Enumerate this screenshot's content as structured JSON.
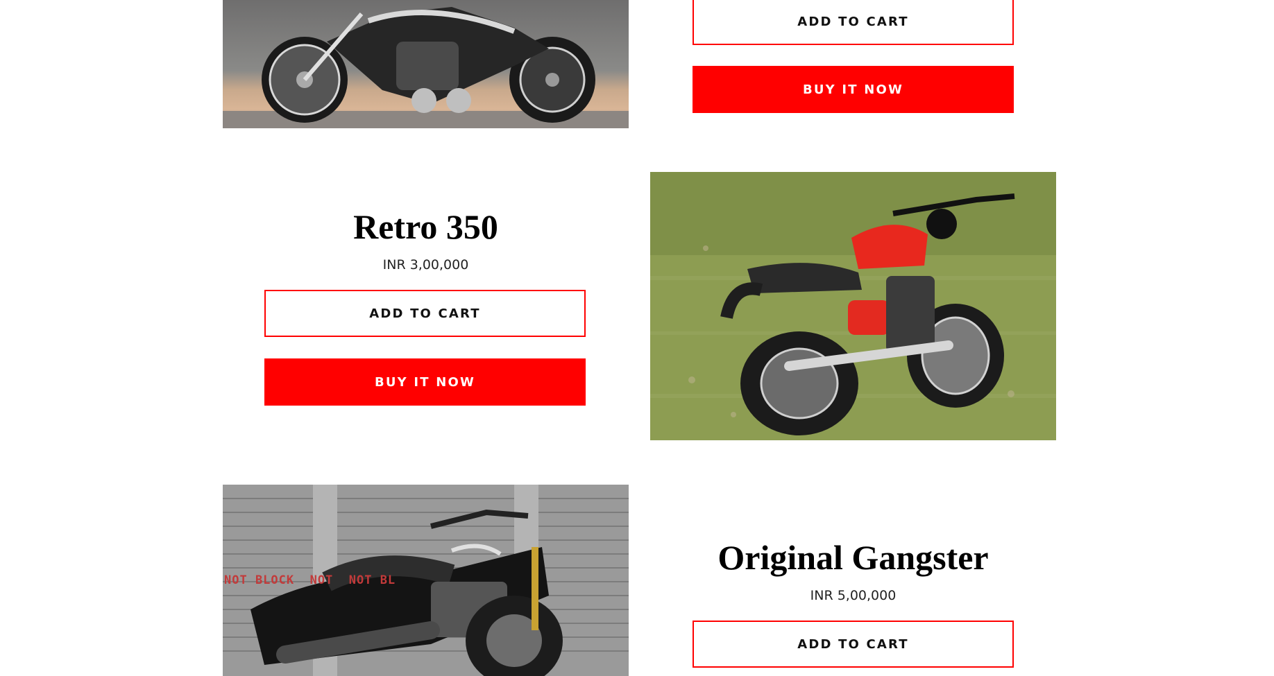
{
  "products": [
    {
      "image_alt": "custom chopper motorcycle",
      "add_to_cart_label": "ADD TO CART",
      "buy_now_label": "BUY IT NOW"
    },
    {
      "title": "Retro 350",
      "price": "INR 3,00,000",
      "image_alt": "red classic motorcycle on grass",
      "add_to_cart_label": "ADD TO CART",
      "buy_now_label": "BUY IT NOW"
    },
    {
      "title": "Original Gangster",
      "price": "INR 5,00,000",
      "image_alt": "black cruiser motorcycle by shutters",
      "add_to_cart_label": "ADD TO CART",
      "wall_text": "NOT BLOCK  NOT  NOT BL"
    }
  ],
  "colors": {
    "accent": "#ff0000",
    "button_outline_text": "#111111",
    "button_solid_text": "#ffffff"
  }
}
